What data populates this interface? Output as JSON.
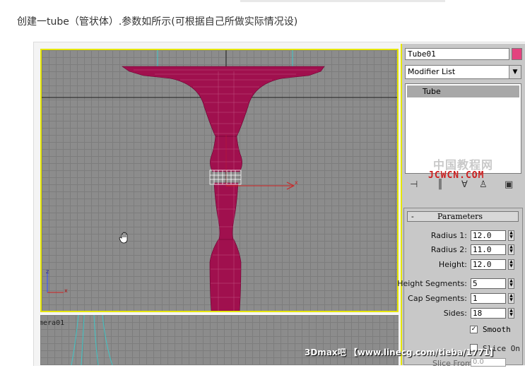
{
  "article": {
    "caption": "创建一tube（管状体）.参数如所示(可根据自己所做实际情况设)"
  },
  "viewport": {
    "axis_x": "x",
    "axis_z": "z",
    "gizmo_x": "x"
  },
  "camera_view": {
    "label": "mera01"
  },
  "command_panel": {
    "object_name": "Tube01",
    "object_color": "#e3437f",
    "modifier_list": "Modifier List",
    "stack_item": "Tube",
    "watermark_cn": "中国教程网",
    "watermark_url": "JCWCN.COM",
    "icons": [
      "pin-stack-icon",
      "show-end-result-icon",
      "make-unique-icon",
      "remove-modifier-icon",
      "configure-sets-icon"
    ],
    "parameters": {
      "title": "Parameters",
      "collapse": "-",
      "rows": [
        {
          "label": "Radius 1:",
          "value": "12.0"
        },
        {
          "label": "Radius 2:",
          "value": "11.0"
        },
        {
          "label": "Height:",
          "value": "12.0"
        },
        {
          "label": "Height Segments:",
          "value": "5"
        },
        {
          "label": "Cap Segments:",
          "value": "1"
        },
        {
          "label": "Sides:",
          "value": "18"
        }
      ],
      "smooth_label": "Smooth",
      "smooth_checked": "✓",
      "slice_on_label": "Slice On",
      "slice_from_label": "Slice From:",
      "slice_from_value": "0.0"
    }
  },
  "footer_watermark": "3Dmax吧 【www.linecg.com/tieba/1771】"
}
